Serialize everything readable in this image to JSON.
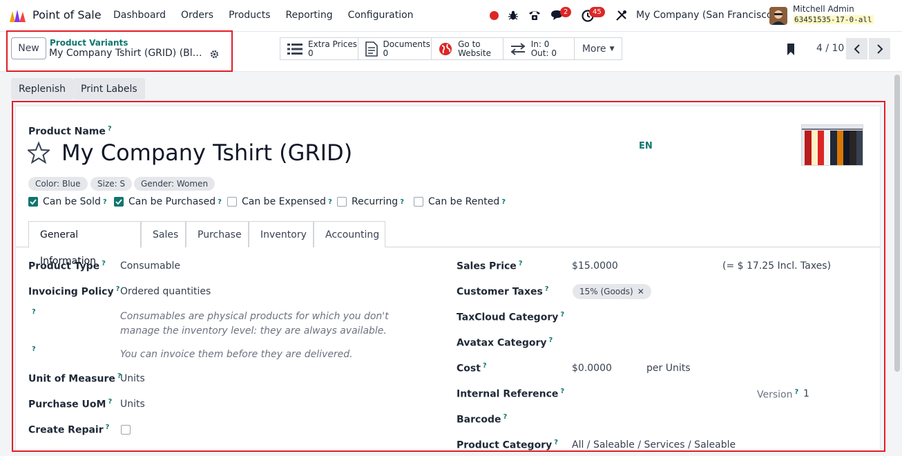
{
  "app": {
    "name": "Point of Sale",
    "icon": "pos-logo-icon"
  },
  "menu": [
    "Dashboard",
    "Orders",
    "Products",
    "Reporting",
    "Configuration"
  ],
  "systray": {
    "messages_count": "2",
    "activities_count": "45"
  },
  "company": "My Company (San Francisco)",
  "user": {
    "name": "Mitchell Admin",
    "database": "63451535-17-0-all"
  },
  "control": {
    "new_label": "New",
    "breadcrumb_parent": "Product Variants",
    "breadcrumb_current": "My Company Tshirt (GRID) (Blue, S, Women)",
    "smart_buttons": [
      {
        "l1": "Extra Prices",
        "l2": "0",
        "icon": "list-icon"
      },
      {
        "l1": "Documents",
        "l2": "0",
        "icon": "document-icon"
      },
      {
        "l1": "Go to",
        "l2": "Website",
        "icon": "globe-icon"
      },
      {
        "l1": "In: 0",
        "l2": "Out: 0",
        "icon": "transfer-icon"
      }
    ],
    "more_label": "More",
    "pager": "4 / 10"
  },
  "status_buttons": [
    "Replenish",
    "Print Labels"
  ],
  "form": {
    "product_name_label": "Product Name",
    "product_name": "My Company Tshirt (GRID)",
    "lang": "EN",
    "variant_tags": [
      "Color: Blue",
      "Size: S",
      "Gender: Women"
    ],
    "checkboxes": [
      {
        "label": "Can be Sold",
        "checked": true
      },
      {
        "label": "Can be Purchased",
        "checked": true
      },
      {
        "label": "Can be Expensed",
        "checked": false
      },
      {
        "label": "Recurring",
        "checked": false
      },
      {
        "label": "Can be Rented",
        "checked": false
      }
    ],
    "tabs": [
      "General Information",
      "Sales",
      "Purchase",
      "Inventory",
      "Accounting"
    ],
    "left": {
      "product_type_label": "Product Type",
      "product_type": "Consumable",
      "invoicing_policy_label": "Invoicing Policy",
      "invoicing_policy": "Ordered quantities",
      "help_consumable": "Consumables are physical products for which you don't manage the inventory level: they are always available.",
      "help_invoice": "You can invoice them before they are delivered.",
      "uom_label": "Unit of Measure",
      "uom": "Units",
      "purchase_uom_label": "Purchase UoM",
      "purchase_uom": "Units",
      "create_repair_label": "Create Repair"
    },
    "right": {
      "sales_price_label": "Sales Price",
      "sales_price": "$15.0000",
      "sales_price_incl": "(= $ 17.25 Incl. Taxes)",
      "customer_taxes_label": "Customer Taxes",
      "customer_tax": "15% (Goods)",
      "taxcloud_label": "TaxCloud Category",
      "avatax_label": "Avatax Category",
      "cost_label": "Cost",
      "cost": "$0.0000",
      "cost_unit": "per Units",
      "internal_ref_label": "Internal Reference",
      "version_label": "Version",
      "version": "1",
      "barcode_label": "Barcode",
      "category_label": "Product Category",
      "category": "All / Saleable / Services / Saleable"
    }
  },
  "colors": {
    "accent": "#0f766e",
    "highlight": "#e11d27",
    "danger": "#dc2626"
  }
}
